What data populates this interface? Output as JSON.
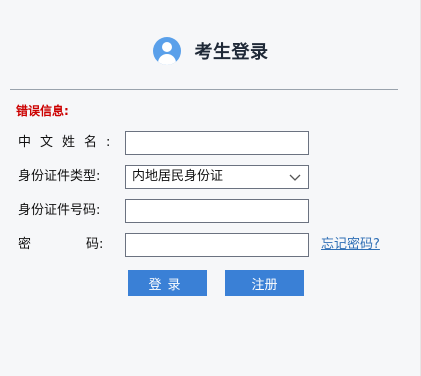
{
  "header": {
    "title": "考生登录",
    "icon": "user-avatar-icon"
  },
  "error": {
    "label": "错误信息:"
  },
  "form": {
    "chinese_name": {
      "label": "中文姓名:",
      "value": ""
    },
    "id_type": {
      "label": "身份证件类型:",
      "value": "内地居民身份证"
    },
    "id_number": {
      "label": "身份证件号码:",
      "value": ""
    },
    "password": {
      "label_a": "密",
      "label_b": "码:",
      "value": ""
    },
    "forgot_link": "忘记密码?"
  },
  "actions": {
    "login_label": "登录",
    "register_label": "注册"
  },
  "colors": {
    "accent": "#3a80d6",
    "error": "#cc0000",
    "link": "#2f6fb5"
  }
}
